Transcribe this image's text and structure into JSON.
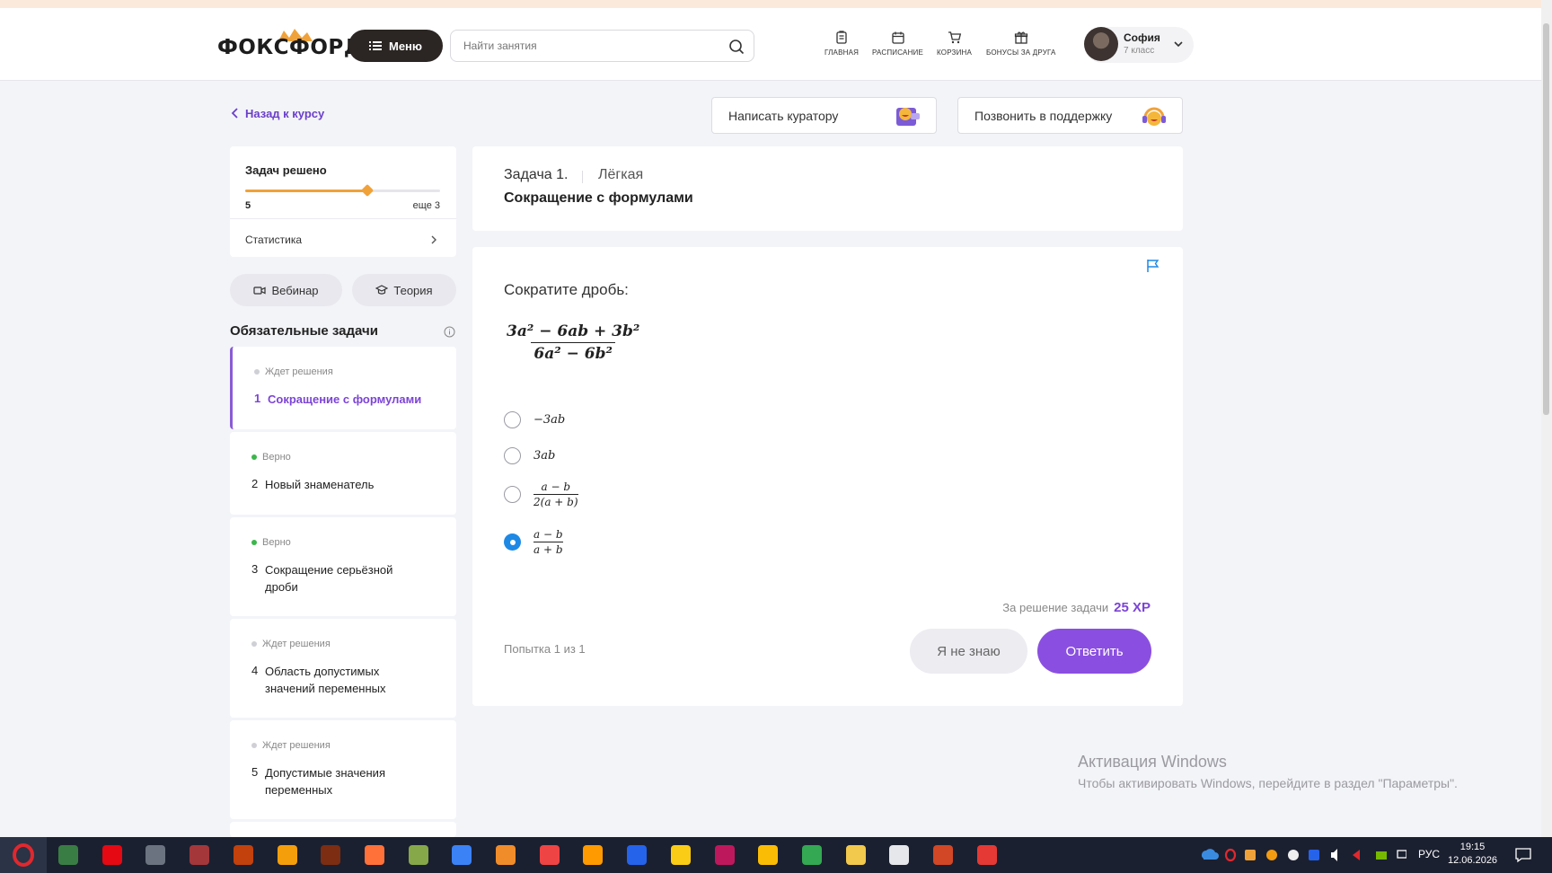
{
  "header": {
    "logo_text": "ФОКСФОРД",
    "menu_label": "Меню",
    "search_placeholder": "Найти занятия",
    "nav": [
      {
        "label": "ГЛАВНАЯ",
        "icon": "document-icon"
      },
      {
        "label": "РАСПИСАНИЕ",
        "icon": "calendar-icon"
      },
      {
        "label": "КОРЗИНА",
        "icon": "cart-icon"
      },
      {
        "label": "БОНУСЫ ЗА ДРУГА",
        "icon": "gift-icon"
      }
    ],
    "user": {
      "name": "София",
      "grade": "7 класс"
    }
  },
  "back_link": "Назад к курсу",
  "help": {
    "curator": "Написать куратору",
    "support": "Позвонить в поддержку"
  },
  "progress": {
    "title": "Задач решено",
    "solved": "5",
    "remaining": "еще 3",
    "fraction": 0.625,
    "stats_label": "Статистика"
  },
  "tabs": {
    "webinar": "Вебинар",
    "theory": "Теория"
  },
  "sidebar": {
    "section_title": "Обязательные задачи",
    "tasks": [
      {
        "status": "Ждет решения",
        "num": "1",
        "name": "Сокращение с формулами",
        "state": "pending",
        "active": true
      },
      {
        "status": "Верно",
        "num": "2",
        "name": "Новый знаменатель",
        "state": "ok"
      },
      {
        "status": "Верно",
        "num": "3",
        "name": "Сокращение серьёзной дроби",
        "state": "ok"
      },
      {
        "status": "Ждет решения",
        "num": "4",
        "name": "Область допустимых значений переменных",
        "state": "pending"
      },
      {
        "status": "Ждет решения",
        "num": "5",
        "name": "Допустимые значения переменных",
        "state": "pending"
      }
    ]
  },
  "task": {
    "number": "Задача 1.",
    "level": "Лёгкая",
    "title": "Сокращение с формулами",
    "prompt": "Сократите дробь:",
    "formula_num": "3a² − 6ab + 3b²",
    "formula_den": "6a² − 6b²",
    "options": [
      {
        "text": "−3ab"
      },
      {
        "text": "3ab"
      },
      {
        "num": "a − b",
        "den": "2(a + b)"
      },
      {
        "num": "a − b",
        "den": "a + b",
        "selected": true
      }
    ],
    "xp_label": "За решение задачи",
    "xp_value": "25 XP",
    "attempt": "Попытка 1 из 1",
    "btn_idk": "Я не знаю",
    "btn_answer": "Ответить"
  },
  "watermark": {
    "line1": "Активация Windows",
    "line2": "Чтобы активировать Windows, перейдите в раздел \"Параметры\"."
  },
  "taskbar": {
    "lang": "РУС",
    "time": "19:15",
    "date": "12.06.2026",
    "apps": [
      "opera",
      "ms-store",
      "netflix",
      "calculator",
      "access",
      "foxit",
      "fl-studio",
      "illustrator-cc",
      "firefox",
      "notepad-plus",
      "media-player",
      "sublime",
      "yandex",
      "illustrator",
      "visio",
      "yandex-music",
      "indesign",
      "chrome",
      "chrome-alt",
      "file-explorer",
      "notepad",
      "powerpoint",
      "wps"
    ]
  },
  "colors": {
    "accent": "#8a4fe0",
    "link": "#6b3fc9",
    "progress": "#f0a23a",
    "radio_on": "#1e88e5",
    "ok": "#3cb64b"
  }
}
